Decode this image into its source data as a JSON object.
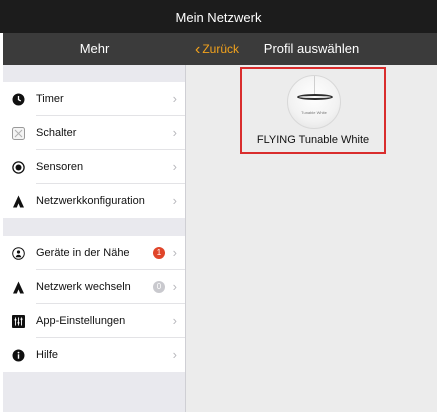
{
  "app": {
    "title": "Mein Netzwerk"
  },
  "sidebar": {
    "header": "Mehr",
    "group1": [
      {
        "label": "Timer",
        "icon": "clock-icon"
      },
      {
        "label": "Schalter",
        "icon": "switch-icon"
      },
      {
        "label": "Sensoren",
        "icon": "sensor-icon"
      },
      {
        "label": "Netzwerkkonfiguration",
        "icon": "network-icon"
      }
    ],
    "group2": [
      {
        "label": "Geräte in der Nähe",
        "icon": "nearby-icon",
        "badge": "1"
      },
      {
        "label": "Netzwerk wechseln",
        "icon": "network-switch-icon",
        "badge": "0"
      },
      {
        "label": "App-Einstellungen",
        "icon": "settings-icon"
      },
      {
        "label": "Hilfe",
        "icon": "info-icon"
      }
    ]
  },
  "main": {
    "back_label": "Zurück",
    "title": "Profil auswählen",
    "profile": {
      "thumb_text": "Tunable White",
      "label": "FLYING Tunable White"
    }
  },
  "colors": {
    "accent": "#f2a21c",
    "highlight": "#d92d2d",
    "badge": "#e0452a"
  }
}
